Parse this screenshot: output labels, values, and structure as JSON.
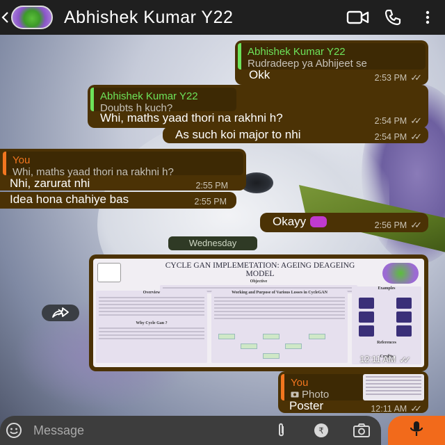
{
  "header": {
    "contact_name": "Abhishek Kumar Y22"
  },
  "messages": [
    {
      "quote_author": "Abhishek Kumar Y22",
      "quote_text": "Rudradeep ya Abhijeet se",
      "text": "Okk",
      "time": "2:53 PM"
    },
    {
      "quote_author": "Abhishek Kumar Y22",
      "quote_text": "Doubts h kuch?",
      "text": "Whi, maths yaad thori na rakhni h?",
      "time": "2:54 PM"
    },
    {
      "text": "As such koi major to nhi",
      "time": "2:54 PM"
    },
    {
      "quote_author": "You",
      "quote_text": "Whi, maths yaad thori na rakhni h?",
      "text": "Nhi, zarurat nhi",
      "time": "2:55 PM"
    },
    {
      "text": "Idea hona chahiye bas",
      "time": "2:55 PM"
    },
    {
      "text": "Okayy",
      "time": "2:56 PM"
    }
  ],
  "day_separator": "Wednesday",
  "poster_message": {
    "title": "CYCLE GAN IMPLEMETATION: AGEING DEAGEING MODEL",
    "sections": {
      "objective": "Objective",
      "overview": "Overview",
      "why": "Why Cycle Gan ?",
      "working": "Working and Purpose of Various Losses in CycleGAN",
      "examples": "Examples",
      "references": "References",
      "credits": "Credits"
    },
    "time": "12:11 AM"
  },
  "photo_reply": {
    "quote_author": "You",
    "quote_label": "Photo",
    "text": "Poster",
    "time": "12:11 AM"
  },
  "input": {
    "placeholder": "Message"
  },
  "icons": {
    "back": "back-arrow-icon",
    "video": "video-call-icon",
    "call": "phone-icon",
    "menu": "more-vert-icon",
    "emoji": "emoji-icon",
    "attach": "attach-icon",
    "rupee": "rupee-icon",
    "camera": "camera-icon",
    "mic": "mic-icon",
    "forward": "forward-icon",
    "hand_emoji": "pointing-hand-emoji"
  },
  "colors": {
    "header_bg": "#1f1f1f",
    "bubble_bg": "#4b3205",
    "quote_green": "#6de35a",
    "quote_orange": "#f2761f",
    "mic_bg": "#f26a1b"
  }
}
